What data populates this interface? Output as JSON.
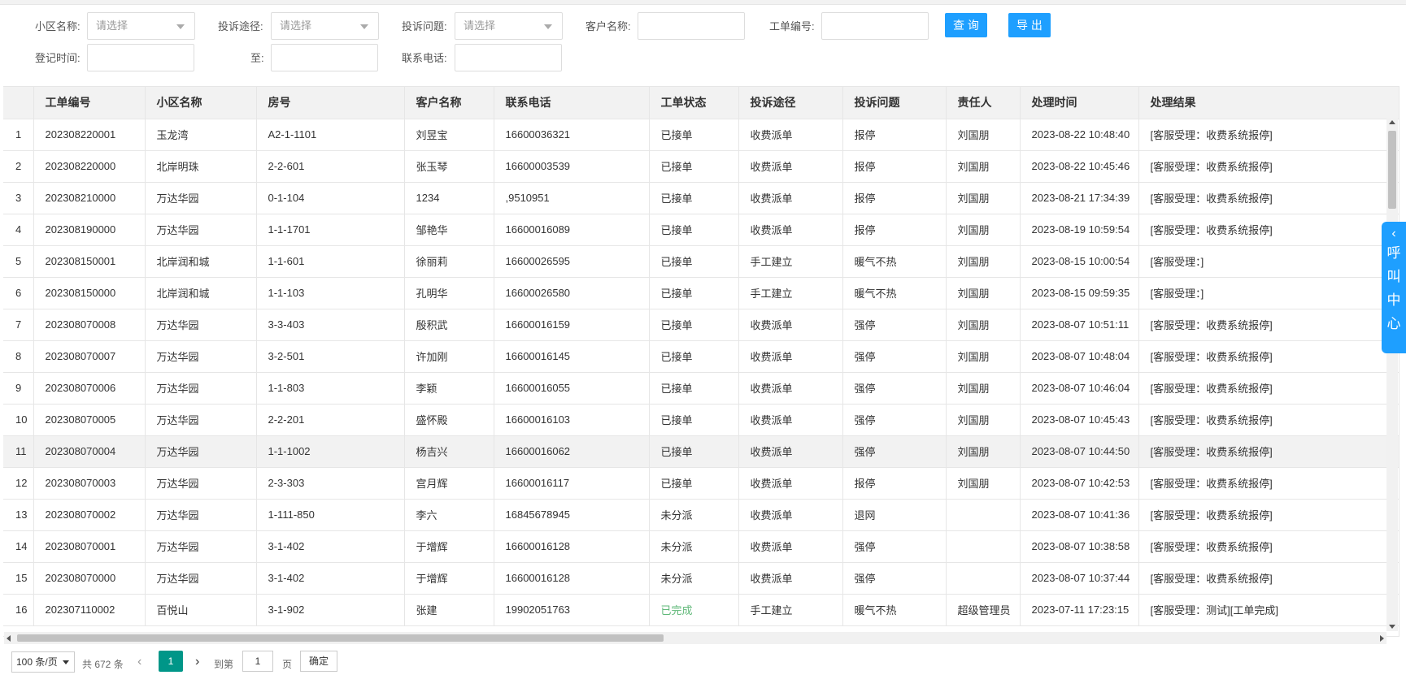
{
  "filters": {
    "community_label": "小区名称:",
    "community_placeholder": "请选择",
    "channel_label": "投诉途径:",
    "channel_placeholder": "请选择",
    "issue_label": "投诉问题:",
    "issue_placeholder": "请选择",
    "customer_label": "客户名称:",
    "ticket_no_label": "工单编号:",
    "search_button": "查 询",
    "export_button": "导 出",
    "reg_time_label": "登记时间:",
    "to_label": "至:",
    "phone_label": "联系电话:"
  },
  "table": {
    "headers": [
      "",
      "工单编号",
      "小区名称",
      "房号",
      "客户名称",
      "联系电话",
      "工单状态",
      "投诉途径",
      "投诉问题",
      "责任人",
      "处理时间",
      "处理结果"
    ],
    "rows": [
      [
        "1",
        "202308220001",
        "玉龙湾",
        "A2-1-1101",
        "刘昱宝",
        "16600036321",
        "已接单",
        "收费派单",
        "报停",
        "刘国朋",
        "2023-08-22 10:48:40",
        "[客服受理：收费系统报停]"
      ],
      [
        "2",
        "202308220000",
        "北岸明珠",
        "2-2-601",
        "张玉琴",
        "16600003539",
        "已接单",
        "收费派单",
        "报停",
        "刘国朋",
        "2023-08-22 10:45:46",
        "[客服受理：收费系统报停]"
      ],
      [
        "3",
        "202308210000",
        "万达华园",
        "0-1-104",
        "1234",
        ",9510951",
        "已接单",
        "收费派单",
        "报停",
        "刘国朋",
        "2023-08-21 17:34:39",
        "[客服受理：收费系统报停]"
      ],
      [
        "4",
        "202308190000",
        "万达华园",
        "1-1-1701",
        "邹艳华",
        "16600016089",
        "已接单",
        "收费派单",
        "报停",
        "刘国朋",
        "2023-08-19 10:59:54",
        "[客服受理：收费系统报停]"
      ],
      [
        "5",
        "202308150001",
        "北岸润和城",
        "1-1-601",
        "徐丽莉",
        "16600026595",
        "已接单",
        "手工建立",
        "暖气不热",
        "刘国朋",
        "2023-08-15 10:00:54",
        "[客服受理：]"
      ],
      [
        "6",
        "202308150000",
        "北岸润和城",
        "1-1-103",
        "孔明华",
        "16600026580",
        "已接单",
        "手工建立",
        "暖气不热",
        "刘国朋",
        "2023-08-15 09:59:35",
        "[客服受理：]"
      ],
      [
        "7",
        "202308070008",
        "万达华园",
        "3-3-403",
        "殷积武",
        "16600016159",
        "已接单",
        "收费派单",
        "强停",
        "刘国朋",
        "2023-08-07 10:51:11",
        "[客服受理：收费系统报停]"
      ],
      [
        "8",
        "202308070007",
        "万达华园",
        "3-2-501",
        "许加刚",
        "16600016145",
        "已接单",
        "收费派单",
        "强停",
        "刘国朋",
        "2023-08-07 10:48:04",
        "[客服受理：收费系统报停]"
      ],
      [
        "9",
        "202308070006",
        "万达华园",
        "1-1-803",
        "李颖",
        "16600016055",
        "已接单",
        "收费派单",
        "强停",
        "刘国朋",
        "2023-08-07 10:46:04",
        "[客服受理：收费系统报停]"
      ],
      [
        "10",
        "202308070005",
        "万达华园",
        "2-2-201",
        "盛怀殿",
        "16600016103",
        "已接单",
        "收费派单",
        "强停",
        "刘国朋",
        "2023-08-07 10:45:43",
        "[客服受理：收费系统报停]"
      ],
      [
        "11",
        "202308070004",
        "万达华园",
        "1-1-1002",
        "杨吉兴",
        "16600016062",
        "已接单",
        "收费派单",
        "强停",
        "刘国朋",
        "2023-08-07 10:44:50",
        "[客服受理：收费系统报停]"
      ],
      [
        "12",
        "202308070003",
        "万达华园",
        "2-3-303",
        "宫月辉",
        "16600016117",
        "已接单",
        "收费派单",
        "报停",
        "刘国朋",
        "2023-08-07 10:42:53",
        "[客服受理：收费系统报停]"
      ],
      [
        "13",
        "202308070002",
        "万达华园",
        "1-111-850",
        "李六",
        "16845678945",
        "未分派",
        "收费派单",
        "退网",
        "",
        "2023-08-07 10:41:36",
        "[客服受理：收费系统报停]"
      ],
      [
        "14",
        "202308070001",
        "万达华园",
        "3-1-402",
        "于增辉",
        "16600016128",
        "未分派",
        "收费派单",
        "强停",
        "",
        "2023-08-07 10:38:58",
        "[客服受理：收费系统报停]"
      ],
      [
        "15",
        "202308070000",
        "万达华园",
        "3-1-402",
        "于增辉",
        "16600016128",
        "未分派",
        "收费派单",
        "强停",
        "",
        "2023-08-07 10:37:44",
        "[客服受理：收费系统报停]"
      ],
      [
        "16",
        "202307110002",
        "百悦山",
        "3-1-902",
        "张建",
        "19902051763",
        "已完成",
        "手工建立",
        "暖气不热",
        "超级管理员",
        "2023-07-11 17:23:15",
        "[客服受理：测试][工单完成]"
      ]
    ]
  },
  "pager": {
    "page_size": "100 条/页",
    "total": "共 672 条",
    "current_page": "1",
    "goto_label": "到第",
    "goto_value": "1",
    "page_suffix": "页",
    "confirm": "确定"
  },
  "call_center": {
    "label": "呼叫中心"
  },
  "colors": {
    "primary_button": "#1e9fff",
    "pager_current": "#009688",
    "status_done": "#5fb878",
    "highlight_row": "#f2f2f2"
  }
}
